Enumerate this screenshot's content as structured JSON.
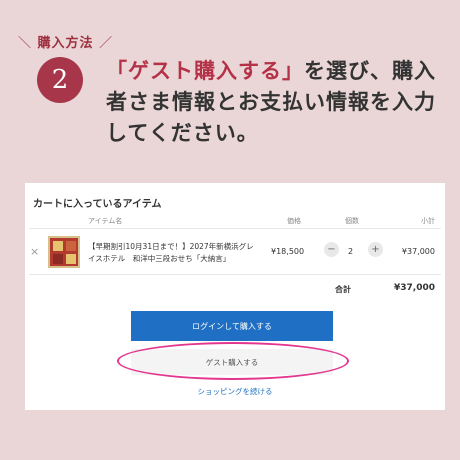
{
  "heading": {
    "tag": "購入方法"
  },
  "step": {
    "number": "2",
    "text_highlight": "「ゲスト購入する」",
    "text_rest": "を選び、購入者さま情報とお支払い情報を入力してください。"
  },
  "cart": {
    "title": "カートに入っているアイテム",
    "columns": {
      "item": "アイテム名",
      "price": "価格",
      "quantity": "個数",
      "subtotal": "小計"
    },
    "items": [
      {
        "name": "【早期割引10月31日まで！】2027年新横浜グレイスホテル　和洋中三段おせち「大納言」",
        "price": "¥18,500",
        "quantity": "2",
        "subtotal": "¥37,000"
      }
    ],
    "remove_symbol": "×",
    "decrement_symbol": "−",
    "increment_symbol": "+",
    "total_label": "合計",
    "total_value": "¥37,000",
    "login_button": "ログインして購入する",
    "guest_button": "ゲスト購入する",
    "continue_link": "ショッピングを続ける"
  },
  "colors": {
    "accent": "#a8364a",
    "highlight_ring": "#e3378f",
    "primary_button": "#1f6fc4"
  }
}
